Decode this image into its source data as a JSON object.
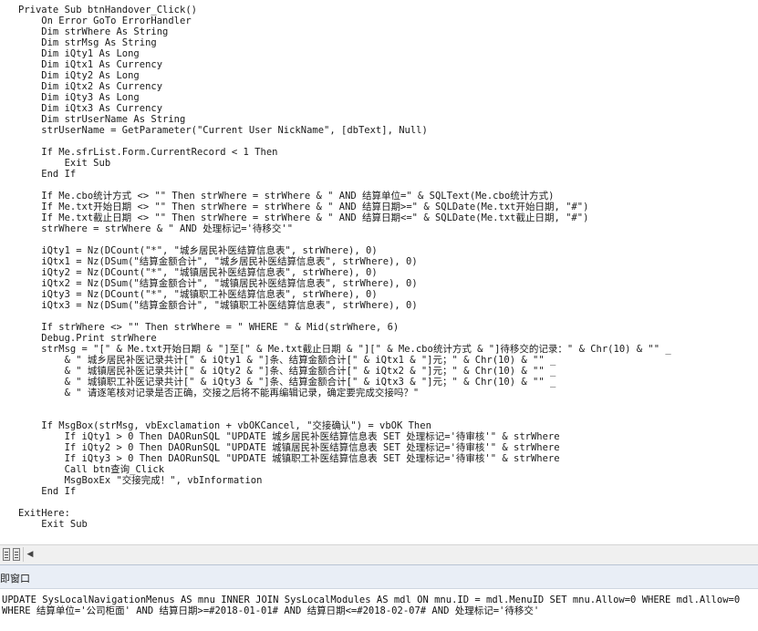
{
  "editor": {
    "lines": [
      "Private Sub btnHandover_Click()",
      "    On Error GoTo ErrorHandler",
      "    Dim strWhere As String",
      "    Dim strMsg As String",
      "    Dim iQty1 As Long",
      "    Dim iQtx1 As Currency",
      "    Dim iQty2 As Long",
      "    Dim iQtx2 As Currency",
      "    Dim iQty3 As Long",
      "    Dim iQtx3 As Currency",
      "    Dim strUserName As String",
      "    strUserName = GetParameter(\"Current User NickName\", [dbText], Null)",
      "",
      "    If Me.sfrList.Form.CurrentRecord < 1 Then",
      "        Exit Sub",
      "    End If",
      "",
      "    If Me.cbo统计方式 <> \"\" Then strWhere = strWhere & \" AND 结算单位=\" & SQLText(Me.cbo统计方式)",
      "    If Me.txt开始日期 <> \"\" Then strWhere = strWhere & \" AND 结算日期>=\" & SQLDate(Me.txt开始日期, \"#\")",
      "    If Me.txt截止日期 <> \"\" Then strWhere = strWhere & \" AND 结算日期<=\" & SQLDate(Me.txt截止日期, \"#\")",
      "    strWhere = strWhere & \" AND 处理标记='待移交'\"",
      "",
      "    iQty1 = Nz(DCount(\"*\", \"城乡居民补医结算信息表\", strWhere), 0)",
      "    iQtx1 = Nz(DSum(\"结算金额合计\", \"城乡居民补医结算信息表\", strWhere), 0)",
      "    iQty2 = Nz(DCount(\"*\", \"城镇居民补医结算信息表\", strWhere), 0)",
      "    iQtx2 = Nz(DSum(\"结算金额合计\", \"城镇居民补医结算信息表\", strWhere), 0)",
      "    iQty3 = Nz(DCount(\"*\", \"城镇职工补医结算信息表\", strWhere), 0)",
      "    iQtx3 = Nz(DSum(\"结算金额合计\", \"城镇职工补医结算信息表\", strWhere), 0)",
      "",
      "    If strWhere <> \"\" Then strWhere = \" WHERE \" & Mid(strWhere, 6)",
      "    Debug.Print strWhere",
      "    strMsg = \"[\" & Me.txt开始日期 & \"]至[\" & Me.txt截止日期 & \"][\" & Me.cbo统计方式 & \"]待移交的记录：\" & Chr(10) & \"\" _",
      "        & \" 城乡居民补医记录共计[\" & iQty1 & \"]条、结算金额合计[\" & iQtx1 & \"]元；\" & Chr(10) & \"\" _",
      "        & \" 城镇居民补医记录共计[\" & iQty2 & \"]条、结算金额合计[\" & iQtx2 & \"]元；\" & Chr(10) & \"\" _",
      "        & \" 城镇职工补医记录共计[\" & iQty3 & \"]条、结算金额合计[\" & iQtx3 & \"]元；\" & Chr(10) & \"\" _",
      "        & \" 请逐笔核对记录是否正确，交接之后将不能再编辑记录，确定要完成交接吗？\"",
      "",
      "",
      "    If MsgBox(strMsg, vbExclamation + vbOKCancel, \"交接确认\") = vbOK Then",
      "        If iQty1 > 0 Then DAORunSQL \"UPDATE 城乡居民补医结算信息表 SET 处理标记='待审核'\" & strWhere",
      "        If iQty2 > 0 Then DAORunSQL \"UPDATE 城镇居民补医结算信息表 SET 处理标记='待审核'\" & strWhere",
      "        If iQty3 > 0 Then DAORunSQL \"UPDATE 城镇职工补医结算信息表 SET 处理标记='待审核'\" & strWhere",
      "        Call btn查询_Click",
      "        MsgBoxEx \"交接完成！\", vbInformation",
      "    End If",
      "",
      "ExitHere:",
      "    Exit Sub"
    ]
  },
  "scrollbar": {
    "left_arrow": "◀"
  },
  "immediate": {
    "title": "即窗口",
    "lines": [
      "UPDATE SysLocalNavigationMenus AS mnu INNER JOIN SysLocalModules AS mdl ON mnu.ID = mdl.MenuID SET mnu.Allow=0 WHERE mdl.Allow=0",
      "WHERE 结算单位='公司柜面' AND 结算日期>=#2018-01-01# AND 结算日期<=#2018-02-07# AND 处理标记='待移交'"
    ]
  },
  "colors": {
    "keyword": "#00008b",
    "text": "#1a1a1a",
    "titlebar": "#e9eef6"
  }
}
